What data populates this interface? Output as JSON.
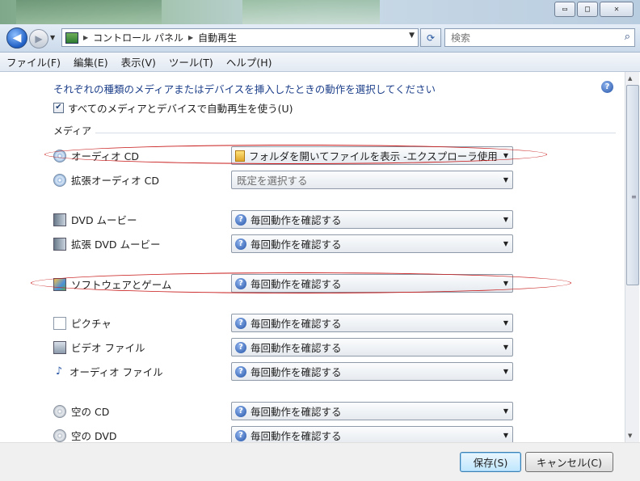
{
  "window": {
    "minimize": "▭",
    "maximize": "□",
    "close": "✕"
  },
  "address": {
    "segments": [
      "コントロール パネル",
      "自動再生"
    ]
  },
  "search": {
    "placeholder": "検索"
  },
  "menu": [
    "ファイル(F)",
    "編集(E)",
    "表示(V)",
    "ツール(T)",
    "ヘルプ(H)"
  ],
  "main": {
    "instruction": "それぞれの種類のメディアまたはデバイスを挿入したときの動作を選択してください",
    "use_all_label": "すべてのメディアとデバイスで自動再生を使う(U)",
    "use_all_checked": true,
    "section_media": "メディア"
  },
  "media": [
    {
      "label": "オーディオ CD",
      "icon": "cd-audio-icon",
      "value": "フォルダを開いてファイルを表示 -エクスプローラ使用",
      "value_icon": "folder-icon"
    },
    {
      "label": "拡張オーディオ CD",
      "icon": "enhanced-cd-icon",
      "value": "既定を選択する",
      "value_icon": ""
    },
    {
      "label": "DVD ムービー",
      "icon": "dvd-movie-icon",
      "value": "毎回動作を確認する",
      "value_icon": "question-icon"
    },
    {
      "label": "拡張 DVD ムービー",
      "icon": "enhanced-dvd-icon",
      "value": "毎回動作を確認する",
      "value_icon": "question-icon"
    },
    {
      "label": "ソフトウェアとゲーム",
      "icon": "software-games-icon",
      "value": "毎回動作を確認する",
      "value_icon": "question-icon"
    },
    {
      "label": "ピクチャ",
      "icon": "picture-icon",
      "value": "毎回動作を確認する",
      "value_icon": "question-icon"
    },
    {
      "label": "ビデオ ファイル",
      "icon": "video-file-icon",
      "value": "毎回動作を確認する",
      "value_icon": "question-icon"
    },
    {
      "label": "オーディオ ファイル",
      "icon": "audio-file-icon",
      "value": "毎回動作を確認する",
      "value_icon": "question-icon"
    },
    {
      "label": "空の CD",
      "icon": "blank-cd-icon",
      "value": "毎回動作を確認する",
      "value_icon": "question-icon"
    },
    {
      "label": "空の DVD",
      "icon": "blank-dvd-icon",
      "value": "毎回動作を確認する",
      "value_icon": "question-icon"
    }
  ],
  "buttons": {
    "save": "保存(S)",
    "cancel": "キャンセル(C)"
  },
  "colors": {
    "highlight_ellipse": "#c81a1a",
    "instruction_text": "#1d3f8a"
  }
}
